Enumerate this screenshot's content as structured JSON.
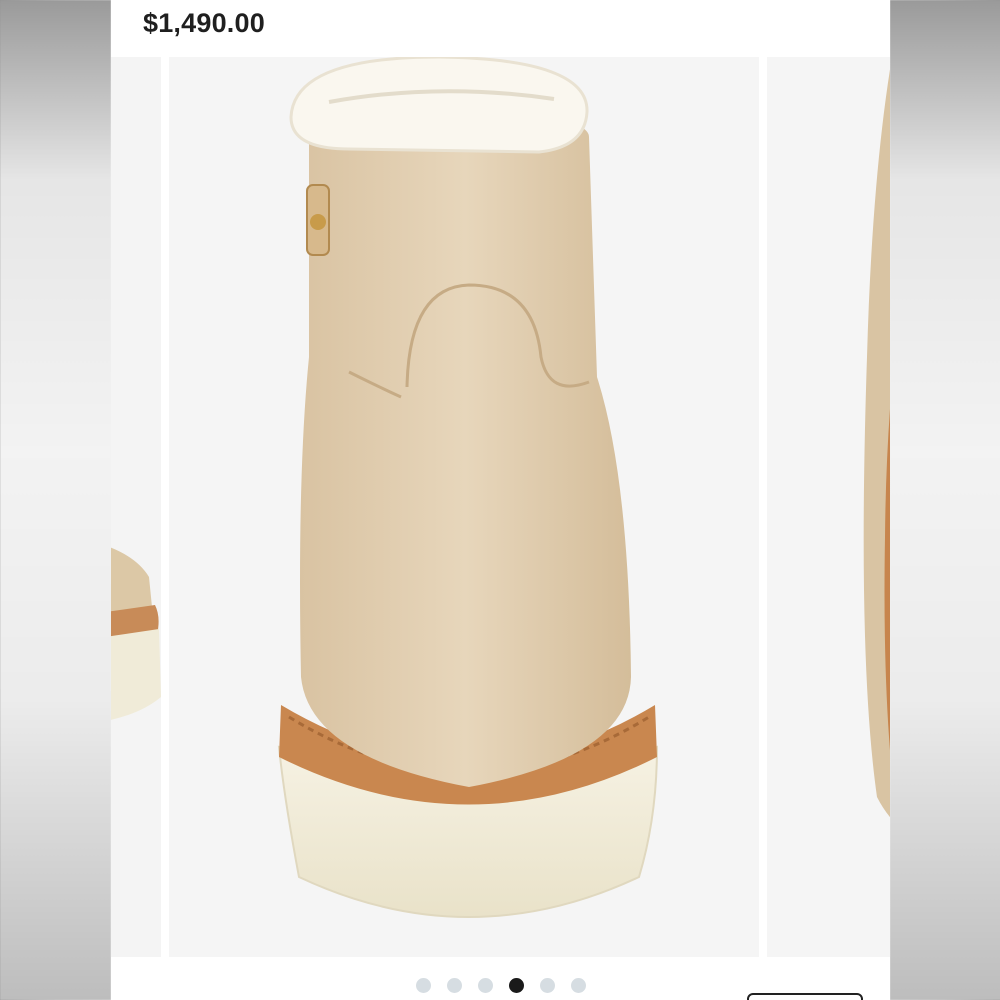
{
  "product": {
    "price": "$1,490.00"
  },
  "gallery": {
    "slide_count": 6,
    "active_index": 3
  }
}
